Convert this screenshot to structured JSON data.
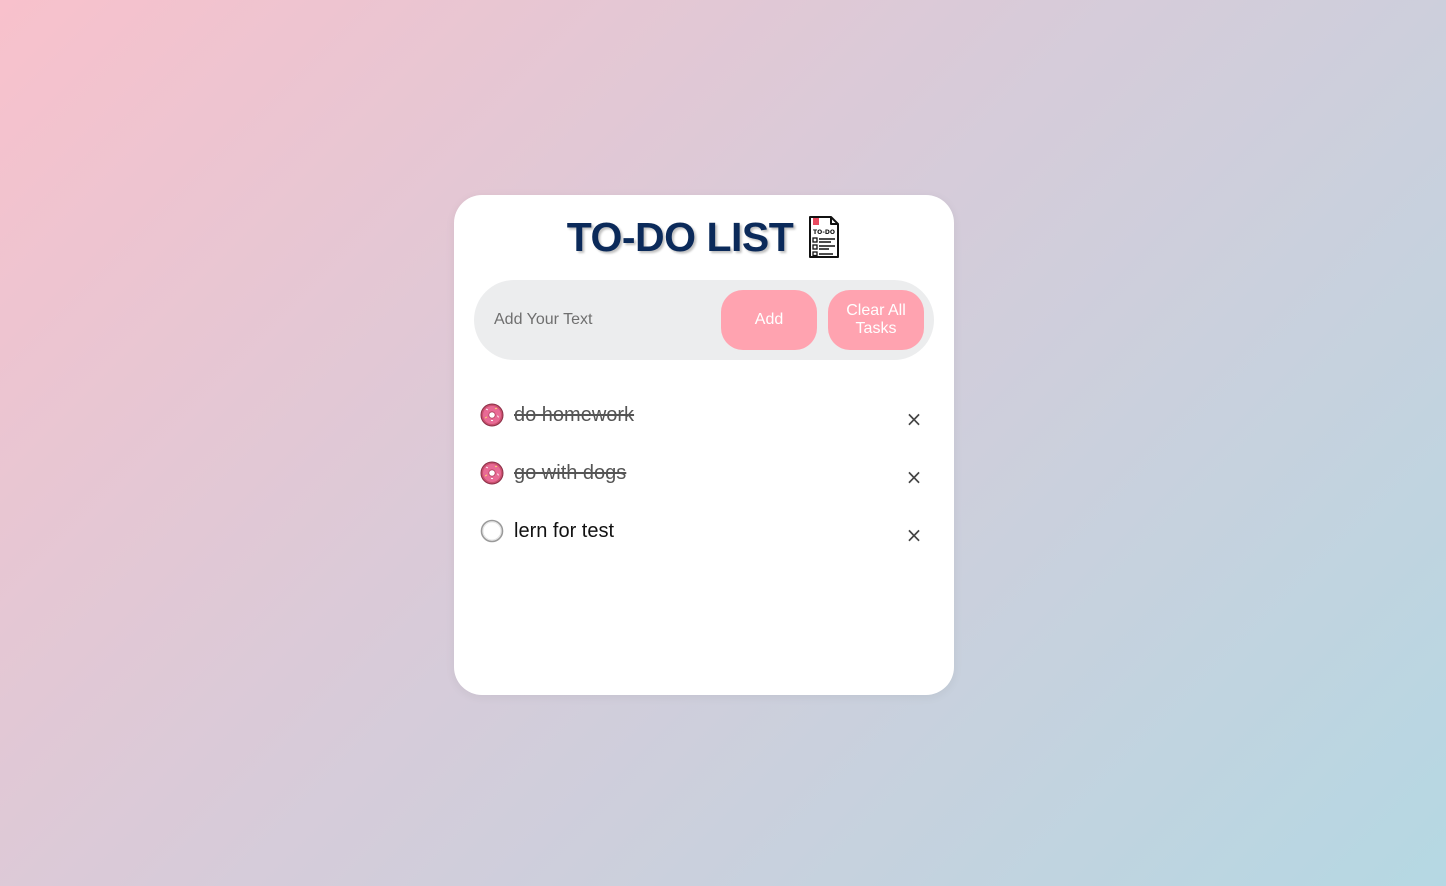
{
  "app": {
    "title": "TO-DO LIST",
    "title_icon": "todo-notepad-icon"
  },
  "input": {
    "placeholder": "Add Your Text",
    "value": ""
  },
  "buttons": {
    "add_label": "Add",
    "clear_label": "Clear All Tasks"
  },
  "tasks": [
    {
      "text": "do homework",
      "checked": true,
      "checked_icon": "donut-icon"
    },
    {
      "text": "go with dogs",
      "checked": true,
      "checked_icon": "donut-icon"
    },
    {
      "text": "lern for test",
      "checked": false,
      "checked_icon": "empty-circle-icon"
    }
  ],
  "close_glyph": "×",
  "colors": {
    "title": "#0b2a5a",
    "button_bg": "#ffa3b0",
    "input_bar_bg": "#ecedee",
    "gradient_start": "#f8c1cc",
    "gradient_end": "#b5d8e3"
  }
}
